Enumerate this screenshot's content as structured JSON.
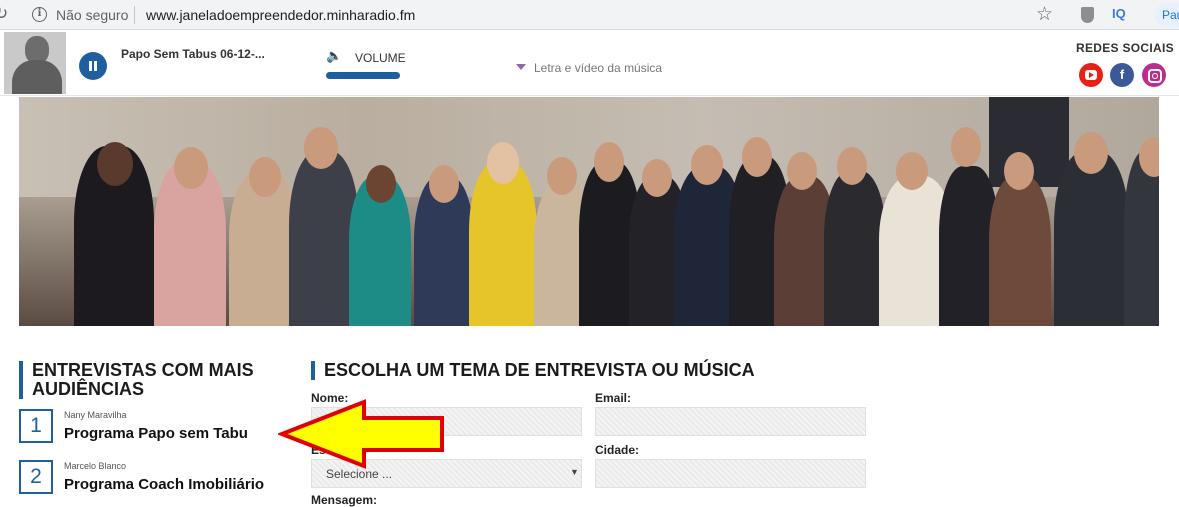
{
  "browser": {
    "security_label": "Não seguro",
    "url": "www.janeladoempreendedor.minharadio.fm",
    "profile_label": "Pau",
    "extension_iq": "IQ"
  },
  "player": {
    "track_title": "Papo Sem Tabus 06-12-...",
    "volume_label": "VOLUME",
    "lyrics_link": "Letra e vídeo da música",
    "social_title": "REDES SOCIAIS",
    "icons": [
      "youtube-icon",
      "facebook-icon",
      "instagram-icon"
    ]
  },
  "sidebar": {
    "heading": "ENTREVISTAS COM MAIS AUDIÊNCIAS",
    "items": [
      {
        "rank": "1",
        "host": "Nany Maravilha",
        "program": "Programa Papo sem Tabu"
      },
      {
        "rank": "2",
        "host": "Marcelo Blanco",
        "program": "Programa Coach Imobiliário"
      }
    ]
  },
  "form": {
    "heading": "ESCOLHA UM TEMA DE ENTREVISTA OU MÚSICA",
    "name_label": "Nome:",
    "email_label": "Email:",
    "state_label": "Es",
    "state_select_value": "Selecione ...",
    "city_label": "Cidade:",
    "message_label": "Mensagem:"
  },
  "colors": {
    "accent": "#1f5fa0",
    "youtube": "#e62117",
    "facebook": "#3b5998",
    "instagram": "#b92d8f",
    "annotation_arrow_fill": "#ffff00",
    "annotation_arrow_stroke": "#e00000"
  }
}
